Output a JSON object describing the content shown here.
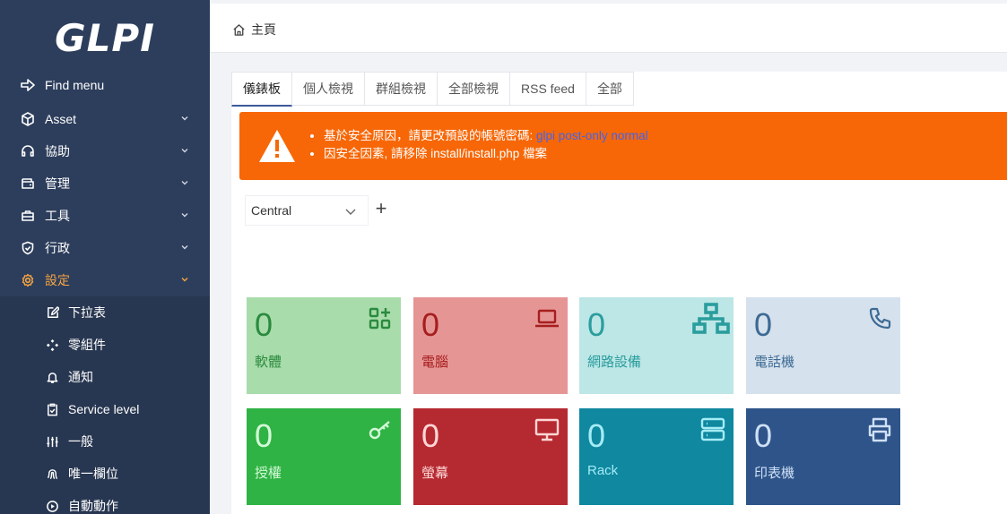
{
  "app": {
    "logo": "GLPI"
  },
  "sidebar": {
    "items": [
      {
        "label": "Find menu",
        "icon": "arrow-right-icon"
      },
      {
        "label": "Asset",
        "icon": "cube-icon"
      },
      {
        "label": "協助",
        "icon": "headset-icon"
      },
      {
        "label": "管理",
        "icon": "wallet-icon"
      },
      {
        "label": "工具",
        "icon": "briefcase-icon"
      },
      {
        "label": "行政",
        "icon": "shield-check-icon"
      },
      {
        "label": "設定",
        "icon": "gear-icon"
      }
    ],
    "subitems": [
      {
        "label": "下拉表",
        "icon": "edit-icon"
      },
      {
        "label": "零組件",
        "icon": "components-icon"
      },
      {
        "label": "通知",
        "icon": "bell-icon"
      },
      {
        "label": "Service level",
        "icon": "clipboard-check-icon"
      },
      {
        "label": "一般",
        "icon": "adjustments-icon"
      },
      {
        "label": "唯一欄位",
        "icon": "fingerprint-icon"
      },
      {
        "label": "自動動作",
        "icon": "settings-automation-icon"
      }
    ]
  },
  "header": {
    "breadcrumb": "主頁"
  },
  "tabs": [
    "儀錶板",
    "個人檢視",
    "群組檢視",
    "全部檢視",
    "RSS feed",
    "全部"
  ],
  "alert": {
    "line1_prefix": "基於安全原因，請更改預設的帳號密碼:",
    "line1_link": "glpi post-only normal",
    "line2": "因安全因素, 請移除 install/install.php 檔案"
  },
  "dashboard": {
    "selected": "Central",
    "add": "+"
  },
  "cards": [
    {
      "value": "0",
      "label": "軟體",
      "icon": "apps-icon",
      "bg": "#a8dcab",
      "fg": "#2b8a3e"
    },
    {
      "value": "0",
      "label": "電腦",
      "icon": "laptop-icon",
      "bg": "#e69595",
      "fg": "#a61e1e"
    },
    {
      "value": "0",
      "label": "網路設備",
      "icon": "network-icon",
      "bg": "#bde6e6",
      "fg": "#2a9d9d"
    },
    {
      "value": "0",
      "label": "電話機",
      "icon": "phone-icon",
      "bg": "#d5e1ed",
      "fg": "#3d6a93"
    },
    {
      "value": "0",
      "label": "授權",
      "icon": "key-icon",
      "bg": "#2fb344",
      "fg": "#d3f9d8"
    },
    {
      "value": "0",
      "label": "螢幕",
      "icon": "monitor-icon",
      "bg": "#b52a31",
      "fg": "#ffd6d6"
    },
    {
      "value": "0",
      "label": "Rack",
      "icon": "server-icon",
      "bg": "#0f88a0",
      "fg": "#a5ecf5"
    },
    {
      "value": "0",
      "label": "印表機",
      "icon": "printer-icon",
      "bg": "#2e548a",
      "fg": "#cfe0f5"
    }
  ]
}
